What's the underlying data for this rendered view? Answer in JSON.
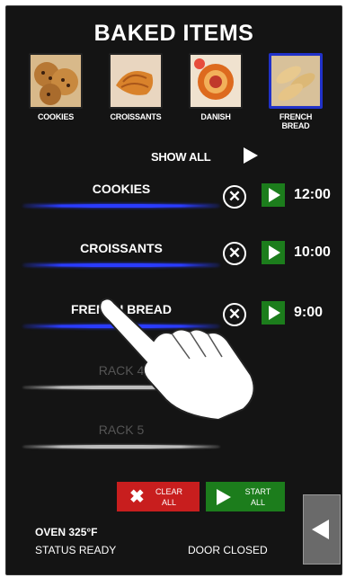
{
  "header": {
    "title": "BAKED ITEMS"
  },
  "categories": [
    {
      "label": "COOKIES",
      "icon": "cookies-image",
      "selected": false
    },
    {
      "label": "CROISSANTS",
      "icon": "croissants-image",
      "selected": false
    },
    {
      "label": "DANISH",
      "icon": "danish-image",
      "selected": false
    },
    {
      "label": "FRENCH\nBREAD",
      "icon": "french-bread-image",
      "selected": true
    }
  ],
  "show_all": {
    "label": "SHOW ALL"
  },
  "racks": [
    {
      "label": "COOKIES",
      "time": "12:00",
      "active": true
    },
    {
      "label": "CROISSANTS",
      "time": "10:00",
      "active": true
    },
    {
      "label": "FRENCH BREAD",
      "time": "9:00",
      "active": true
    },
    {
      "label": "RACK 4",
      "time": "",
      "active": false
    },
    {
      "label": "RACK 5",
      "time": "",
      "active": false
    }
  ],
  "actions": {
    "clear_all": "CLEAR\nALL",
    "start_all": "START\nALL"
  },
  "status": {
    "oven_temp": "OVEN 325°F",
    "ready": "STATUS READY",
    "door": "DOOR CLOSED"
  },
  "colors": {
    "panel_bg": "#141414",
    "selected_border": "#2031c9",
    "active_line": "#2a3cff",
    "start_green": "#1c7d1c",
    "clear_red": "#c81e1e"
  }
}
